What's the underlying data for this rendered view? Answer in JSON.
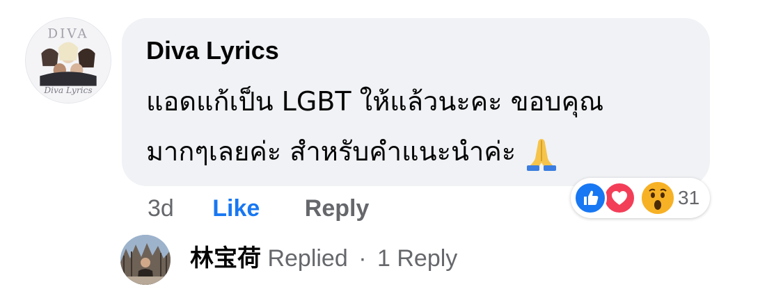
{
  "comment": {
    "author": "Diva Lyrics",
    "avatar_text": "Diva Lyrics",
    "text_line1": "แอดแก้เป็น LGBT ให้แล้วนะคะ ขอบคุณ",
    "text_line2": "มากๆเลยค่ะ สำหรับคำแนะนำค่ะ",
    "emoji": "folded-hands-emoji"
  },
  "actions": {
    "time": "3d",
    "like_label": "Like",
    "reply_label": "Reply"
  },
  "reactions": {
    "types": [
      "like",
      "love",
      "wow"
    ],
    "count": "31"
  },
  "replies": {
    "replier_name": "林宝荷",
    "replied_label": "Replied",
    "separator": "·",
    "reply_count_label": "1 Reply"
  },
  "colors": {
    "link_blue": "#1877f2",
    "bubble_bg": "#f0f2f5",
    "secondary_text": "#65676b",
    "primary_text": "#050505",
    "love_red": "#f33e58",
    "wow_yellow": "#f7b125"
  }
}
